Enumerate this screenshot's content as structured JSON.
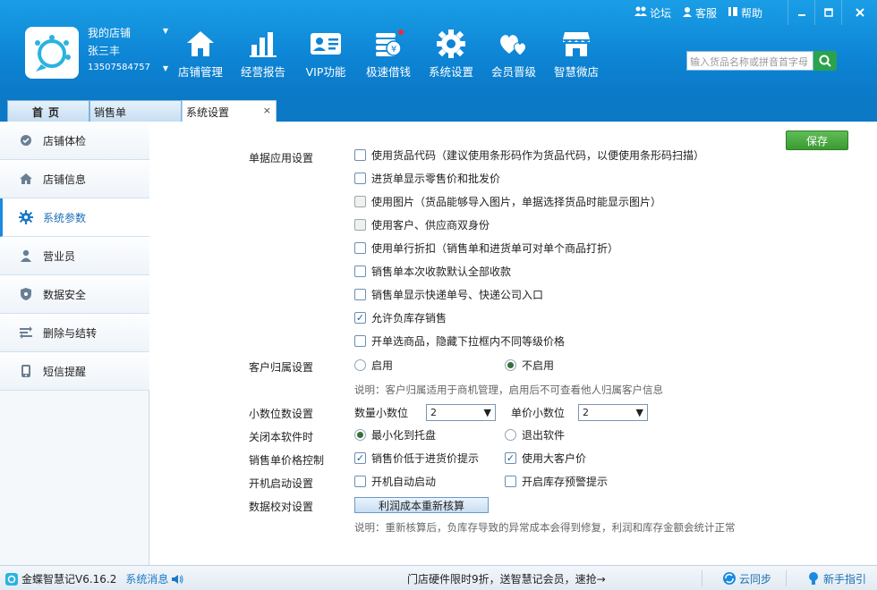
{
  "store": {
    "name": "我的店铺",
    "user": "张三丰",
    "phone": "13507584757"
  },
  "nav": [
    {
      "id": "store",
      "label": "店铺管理"
    },
    {
      "id": "report",
      "label": "经营报告"
    },
    {
      "id": "vip",
      "label": "VIP功能"
    },
    {
      "id": "loan",
      "label": "极速借钱"
    },
    {
      "id": "settings",
      "label": "系统设置"
    },
    {
      "id": "member",
      "label": "会员晋级"
    },
    {
      "id": "wstore",
      "label": "智慧微店"
    }
  ],
  "top_links": {
    "forum": "论坛",
    "service": "客服",
    "help": "帮助"
  },
  "search": {
    "placeholder": "输入货品名称或拼音首字母"
  },
  "tabs": {
    "home": "首页",
    "sales": "销售单",
    "settings": "系统设置",
    "close": "×"
  },
  "sidebar": [
    {
      "label": "店铺体检"
    },
    {
      "label": "店铺信息"
    },
    {
      "label": "系统参数"
    },
    {
      "label": "营业员"
    },
    {
      "label": "数据安全"
    },
    {
      "label": "删除与结转"
    },
    {
      "label": "短信提醒"
    }
  ],
  "main": {
    "save": "保存",
    "doc_settings": {
      "label": "单据应用设置",
      "options": [
        {
          "text": "使用货品代码（建议使用条形码作为货品代码，以便使用条形码扫描）",
          "checked": false
        },
        {
          "text": "进货单显示零售价和批发价",
          "checked": false
        },
        {
          "text": "使用图片（货品能够导入图片，单据选择货品时能显示图片）",
          "checked": false
        },
        {
          "text": "使用客户、供应商双身份",
          "checked": false
        },
        {
          "text": "使用单行折扣（销售单和进货单可对单个商品打折）",
          "checked": false
        },
        {
          "text": "销售单本次收款默认全部收款",
          "checked": false
        },
        {
          "text": "销售单显示快递单号、快递公司入口",
          "checked": false
        },
        {
          "text": "允许负库存销售",
          "checked": true
        },
        {
          "text": "开单选商品，隐藏下拉框内不同等级价格",
          "checked": false
        }
      ]
    },
    "customer": {
      "label": "客户归属设置",
      "opt_on": "启用",
      "opt_off": "不启用",
      "note": "说明：客户归属适用于商机管理，启用后不可查看他人归属客户信息"
    },
    "decimals": {
      "label": "小数位数设置",
      "qty_label": "数量小数位",
      "qty_value": "2",
      "price_label": "单价小数位",
      "price_value": "2"
    },
    "close_app": {
      "label": "关闭本软件时",
      "opt1": "最小化到托盘",
      "opt2": "退出软件"
    },
    "price_ctrl": {
      "label": "销售单价格控制",
      "opt1": "销售价低于进货价提示",
      "opt2": "使用大客户价"
    },
    "startup": {
      "label": "开机启动设置",
      "opt1": "开机自动启动",
      "opt2": "开启库存预警提示"
    },
    "check": {
      "label": "数据校对设置",
      "button": "利润成本重新核算",
      "note": "说明：重新核算后，负库存导致的异常成本会得到修复，利润和库存金额会统计正常"
    }
  },
  "status": {
    "app": "金蝶智慧记V6.16.2",
    "msg": "系统消息",
    "promo": "门店硬件限时9折，送智慧记会员，速抢→",
    "sync": "云同步",
    "guide": "新手指引"
  },
  "colors": {
    "header": "#0d84d4",
    "accent": "#1a8ae0",
    "save": "#3b9a33"
  }
}
